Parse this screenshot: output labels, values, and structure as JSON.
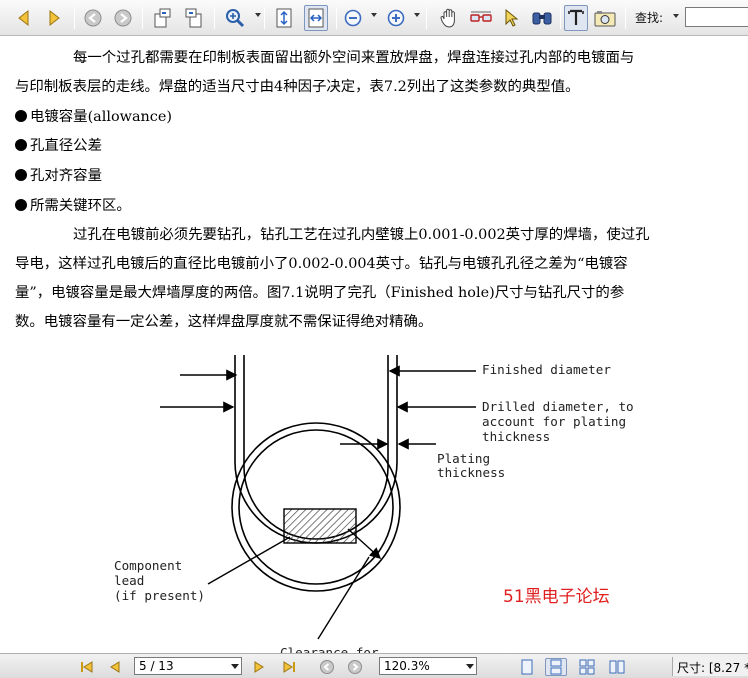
{
  "toolbar": {
    "find_label": "查找:",
    "find_value": ""
  },
  "document": {
    "para1_line1": "每一个过孔都需要在印制板表面留出额外空间来置放焊盘，焊盘连接过孔内部的电镀面与",
    "para1_line2": "与印制板表层的走线。焊盘的适当尺寸由4种因子决定，表7.2列出了这类参数的典型值。",
    "bullets": [
      "电镀容量(allowance)",
      "孔直径公差",
      "孔对齐容量",
      "所需关键环区。"
    ],
    "para2_line1": "过孔在电镀前必须先要钻孔，钻孔工艺在过孔内壁镀上0.001-0.002英寸厚的焊墙，使过孔",
    "para2_line2": "导电，这样过孔电镀后的直径比电镀前小了0.002-0.004英寸。钻孔与电镀孔孔径之差为“电镀容",
    "para2_line3": "量”，电镀容量是最大焊墙厚度的两倍。图7.1说明了完孔（Finished hole)尺寸与钻孔尺寸的参",
    "para2_line4": "数。电镀容量有一定公差，这样焊盘厚度就不需保证得绝对精确。"
  },
  "figure": {
    "finished_diameter": "Finished diameter",
    "drilled_line1": "Drilled diameter, to",
    "drilled_line2": "account for plating",
    "drilled_line3": "thickness",
    "plating_line1": "Plating",
    "plating_line2": "thickness",
    "component_line1": "Component",
    "component_line2": "lead",
    "component_line3": "(if present)",
    "clearance_partial": "Clearance for"
  },
  "watermark": "51黑电子论坛",
  "statusbar": {
    "page_value": "5 / 13",
    "zoom_value": "120.3%",
    "size_label": "尺寸: [8.27 *"
  }
}
